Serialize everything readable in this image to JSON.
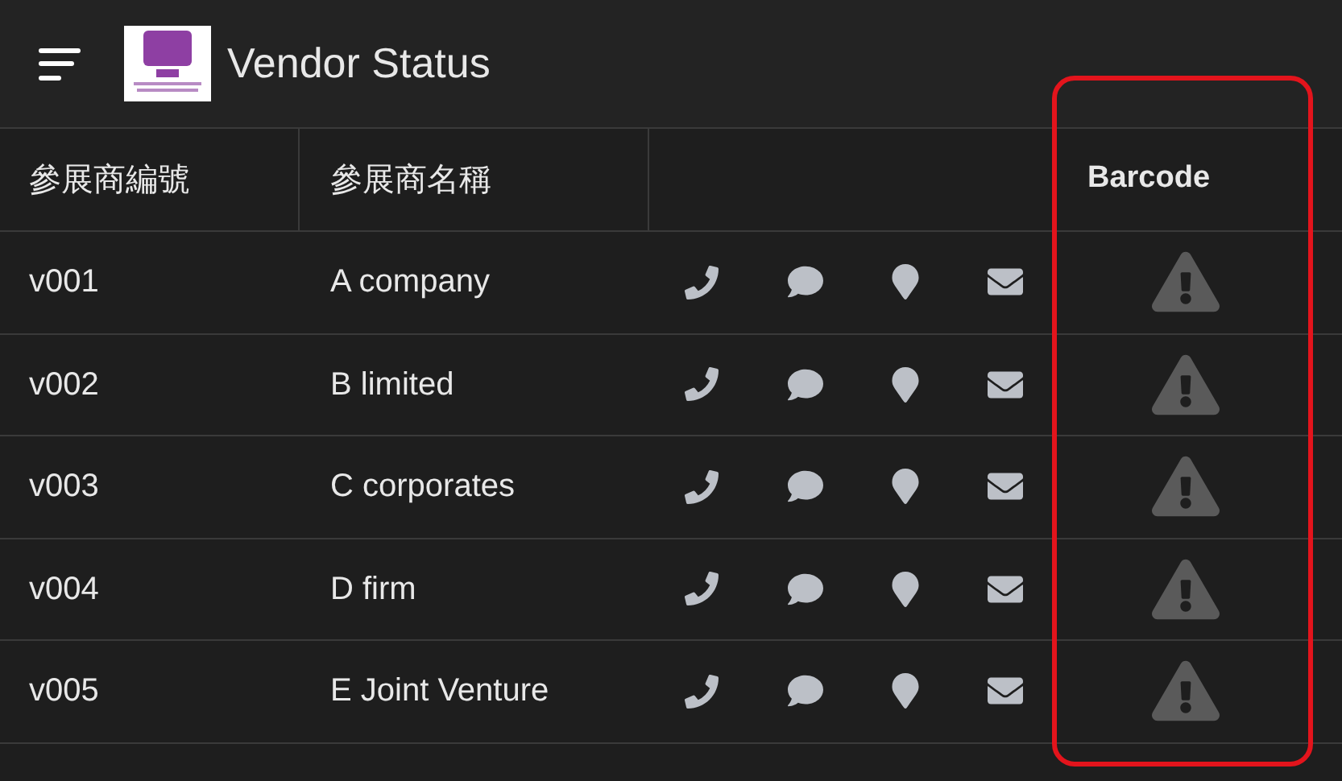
{
  "app_bar": {
    "title": "Vendor Status"
  },
  "table": {
    "columns": [
      "參展商編號",
      "參展商名稱",
      "Barcode"
    ],
    "rows": [
      {
        "id": "v001",
        "name": "A company"
      },
      {
        "id": "v002",
        "name": "B limited"
      },
      {
        "id": "v003",
        "name": "C corporates"
      },
      {
        "id": "v004",
        "name": "D firm"
      },
      {
        "id": "v005",
        "name": "E Joint Venture"
      }
    ]
  }
}
